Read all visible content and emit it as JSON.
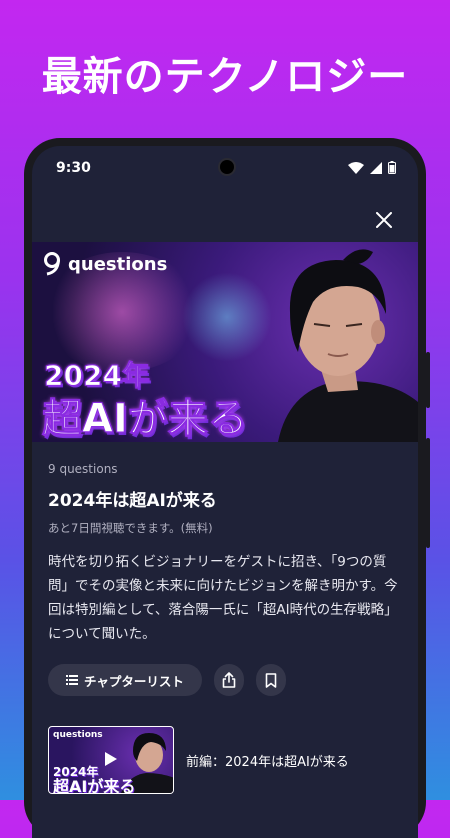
{
  "headline": "最新のテクノロジー",
  "status": {
    "time": "9:30"
  },
  "hero": {
    "logo_text": "questions",
    "year": "2024年",
    "title": "超AIが来る"
  },
  "episode_info": {
    "brand": "9 questions",
    "title": "2024年は超AIが来る",
    "availability": "あと7日間視聴できます。(無料)",
    "description": "時代を切り拓くビジョナリーをゲストに招き、「9つの質問」でその実像と未来に向けたビジョンを解き明かす。今回は特別編として、落合陽一氏に「超AI時代の生存戦略」について聞いた。"
  },
  "actions": {
    "chapter_list_label": "チャプターリスト",
    "share_icon": "share-icon",
    "bookmark_icon": "bookmark-icon"
  },
  "episode_list": [
    {
      "thumb_logo": "questions",
      "thumb_year": "2024年",
      "thumb_title": "超AIが来る",
      "label": "前編：2024年は超AIが来る"
    }
  ],
  "colors": {
    "bg_top": "#c327f0",
    "bg_bottom": "#2f8fe0",
    "screen_bg": "#1f2238",
    "chip_bg": "#34364a"
  }
}
